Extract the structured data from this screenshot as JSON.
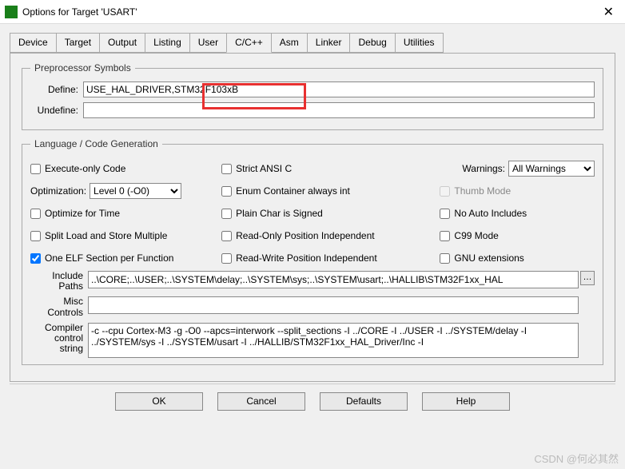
{
  "window": {
    "title": "Options for Target 'USART'",
    "icon": "keil-icon"
  },
  "tabs": [
    "Device",
    "Target",
    "Output",
    "Listing",
    "User",
    "C/C++",
    "Asm",
    "Linker",
    "Debug",
    "Utilities"
  ],
  "active_tab": "C/C++",
  "preprocessor": {
    "legend": "Preprocessor Symbols",
    "define_label": "Define:",
    "define_value": "USE_HAL_DRIVER,STM32F103xB",
    "undefine_label": "Undefine:",
    "undefine_value": ""
  },
  "langgen": {
    "legend": "Language / Code Generation",
    "execute_only": {
      "label": "Execute-only Code",
      "checked": false
    },
    "optimization_label": "Optimization:",
    "optimization_value": "Level 0 (-O0)",
    "optimize_time": {
      "label": "Optimize for Time",
      "checked": false
    },
    "split_load": {
      "label": "Split Load and Store Multiple",
      "checked": false
    },
    "one_elf": {
      "label": "One ELF Section per Function",
      "checked": true
    },
    "strict_ansi": {
      "label": "Strict ANSI C",
      "checked": false
    },
    "enum_container": {
      "label": "Enum Container always int",
      "checked": false
    },
    "plain_char": {
      "label": "Plain Char is Signed",
      "checked": false
    },
    "ro_pi": {
      "label": "Read-Only Position Independent",
      "checked": false
    },
    "rw_pi": {
      "label": "Read-Write Position Independent",
      "checked": false
    },
    "warnings_label": "Warnings:",
    "warnings_value": "All Warnings",
    "thumb_mode": {
      "label": "Thumb Mode",
      "checked": false,
      "disabled": true
    },
    "no_auto_inc": {
      "label": "No Auto Includes",
      "checked": false
    },
    "c99": {
      "label": "C99 Mode",
      "checked": false
    },
    "gnu_ext": {
      "label": "GNU extensions",
      "checked": false
    }
  },
  "paths": {
    "include_label": "Include\nPaths",
    "include_value": "..\\CORE;..\\USER;..\\SYSTEM\\delay;..\\SYSTEM\\sys;..\\SYSTEM\\usart;..\\HALLIB\\STM32F1xx_HAL",
    "misc_label": "Misc\nControls",
    "misc_value": "",
    "compiler_label": "Compiler\ncontrol\nstring",
    "compiler_value": "-c --cpu Cortex-M3 -g -O0 --apcs=interwork --split_sections -I ../CORE -I ../USER -I ../SYSTEM/delay -I ../SYSTEM/sys -I ../SYSTEM/usart -I ../HALLIB/STM32F1xx_HAL_Driver/Inc -I"
  },
  "buttons": {
    "ok": "OK",
    "cancel": "Cancel",
    "defaults": "Defaults",
    "help": "Help"
  },
  "watermark": "CSDN @何必其然"
}
